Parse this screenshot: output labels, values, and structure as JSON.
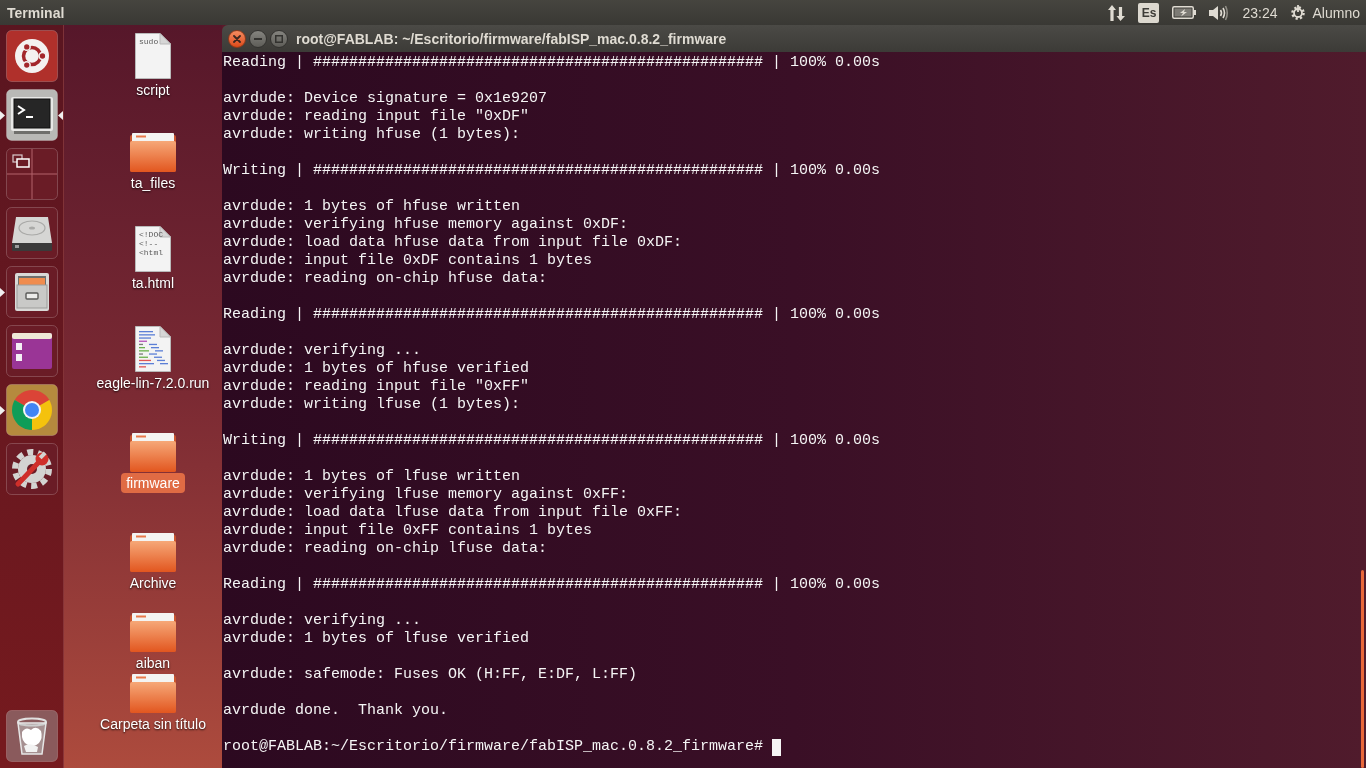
{
  "top_panel": {
    "app_name": "Terminal",
    "indicators": [
      {
        "kind": "network"
      },
      {
        "kind": "keyboard",
        "label": "Es"
      },
      {
        "kind": "battery"
      },
      {
        "kind": "volume"
      },
      {
        "kind": "clock",
        "label": "23:24"
      },
      {
        "kind": "session",
        "label": "Alumno"
      }
    ]
  },
  "launcher": {
    "items": [
      {
        "kind": "dash",
        "running": false,
        "active": false
      },
      {
        "kind": "terminal",
        "running": true,
        "active": true
      },
      {
        "kind": "workspaces",
        "running": false,
        "active": false
      },
      {
        "kind": "drive",
        "running": false,
        "active": false
      },
      {
        "kind": "files",
        "running": true,
        "active": false
      },
      {
        "kind": "app",
        "running": false,
        "active": false
      },
      {
        "kind": "browser",
        "running": true,
        "active": false
      },
      {
        "kind": "settings",
        "running": false,
        "active": false
      },
      {
        "kind": "trash",
        "running": false,
        "active": false
      }
    ]
  },
  "desktop": {
    "icons": [
      {
        "label": "script",
        "kind": "file",
        "preview": [
          "sudo"
        ],
        "selected": false
      },
      {
        "label": "ta_files",
        "kind": "folder",
        "selected": false
      },
      {
        "label": "ta.html",
        "kind": "file",
        "preview": [
          "<!DOC",
          "<!--",
          "<html"
        ],
        "selected": false
      },
      {
        "label": "eagle-lin-7.2.0.run",
        "kind": "listing",
        "selected": false
      },
      {
        "label": "firmware",
        "kind": "folder",
        "selected": true
      },
      {
        "label": "Archive",
        "kind": "folder",
        "selected": false
      },
      {
        "label": "aiban",
        "kind": "folder",
        "selected": false
      },
      {
        "label": "Carpeta sin título",
        "kind": "folder",
        "selected": false
      }
    ]
  },
  "window": {
    "title": "root@FABLAB: ~/Escritorio/firmware/fabISP_mac.0.8.2_firmware",
    "controls": [
      {
        "kind": "close"
      },
      {
        "kind": "minimize"
      },
      {
        "kind": "maximize"
      }
    ],
    "terminal": {
      "blocks": [
        [
          "Reading | ################################################## | 100% 0.00s"
        ],
        [
          "avrdude: Device signature = 0x1e9207",
          "avrdude: reading input file \"0xDF\"",
          "avrdude: writing hfuse (1 bytes):"
        ],
        [
          "Writing | ################################################## | 100% 0.00s"
        ],
        [
          "avrdude: 1 bytes of hfuse written",
          "avrdude: verifying hfuse memory against 0xDF:",
          "avrdude: load data hfuse data from input file 0xDF:",
          "avrdude: input file 0xDF contains 1 bytes",
          "avrdude: reading on-chip hfuse data:"
        ],
        [
          "Reading | ################################################## | 100% 0.00s"
        ],
        [
          "avrdude: verifying ...",
          "avrdude: 1 bytes of hfuse verified",
          "avrdude: reading input file \"0xFF\"",
          "avrdude: writing lfuse (1 bytes):"
        ],
        [
          "Writing | ################################################## | 100% 0.00s"
        ],
        [
          "avrdude: 1 bytes of lfuse written",
          "avrdude: verifying lfuse memory against 0xFF:",
          "avrdude: load data lfuse data from input file 0xFF:",
          "avrdude: input file 0xFF contains 1 bytes",
          "avrdude: reading on-chip lfuse data:"
        ],
        [
          "Reading | ################################################## | 100% 0.00s"
        ],
        [
          "avrdude: verifying ...",
          "avrdude: 1 bytes of lfuse verified"
        ],
        [
          "avrdude: safemode: Fuses OK (H:FF, E:DF, L:FF)"
        ],
        [
          "avrdude done.  Thank you."
        ]
      ],
      "prompt": "root@FABLAB:~/Escritorio/firmware/fabISP_mac.0.8.2_firmware#"
    }
  }
}
